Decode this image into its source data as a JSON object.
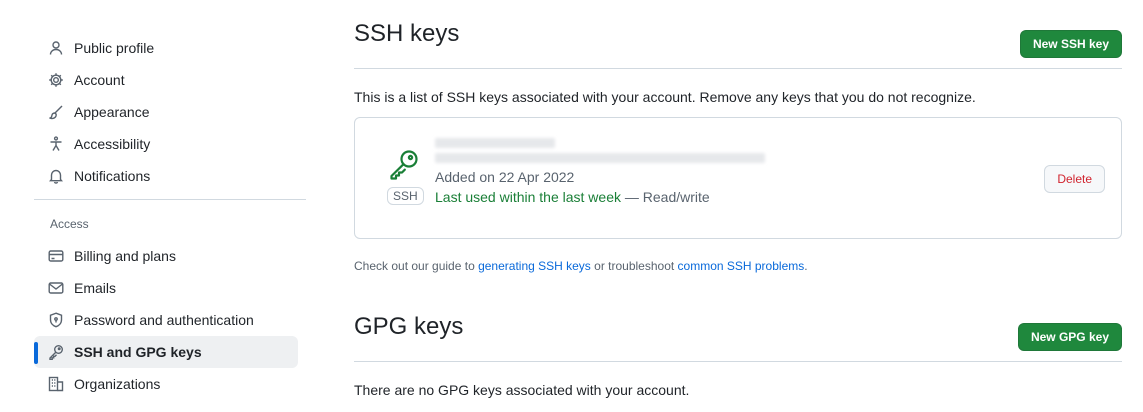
{
  "sidebar": {
    "items_top": [
      {
        "label": "Public profile",
        "icon": "person-icon"
      },
      {
        "label": "Account",
        "icon": "gear-icon"
      },
      {
        "label": "Appearance",
        "icon": "paintbrush-icon"
      },
      {
        "label": "Accessibility",
        "icon": "accessibility-icon"
      },
      {
        "label": "Notifications",
        "icon": "bell-icon"
      }
    ],
    "access_heading": "Access",
    "items_access": [
      {
        "label": "Billing and plans",
        "icon": "credit-card-icon"
      },
      {
        "label": "Emails",
        "icon": "mail-icon"
      },
      {
        "label": "Password and authentication",
        "icon": "shield-lock-icon"
      },
      {
        "label": "SSH and GPG keys",
        "icon": "key-icon",
        "active": true
      },
      {
        "label": "Organizations",
        "icon": "organization-icon"
      }
    ]
  },
  "ssh": {
    "title": "SSH keys",
    "new_button": "New SSH key",
    "description": "This is a list of SSH keys associated with your account. Remove any keys that you do not recognize.",
    "key": {
      "badge": "SSH",
      "added": "Added on 22 Apr 2022",
      "last_used": "Last used within the last week",
      "access": " — Read/write",
      "delete_label": "Delete"
    },
    "guide": {
      "prefix": "Check out our guide to ",
      "link1": "generating SSH keys",
      "middle": " or troubleshoot ",
      "link2": "common SSH problems",
      "suffix": "."
    }
  },
  "gpg": {
    "title": "GPG keys",
    "new_button": "New GPG key",
    "empty": "There are no GPG keys associated with your account."
  },
  "colors": {
    "primary_green": "#1f883d",
    "link_blue": "#0969da",
    "danger_red": "#d1242f",
    "key_green": "#1a7f37"
  }
}
